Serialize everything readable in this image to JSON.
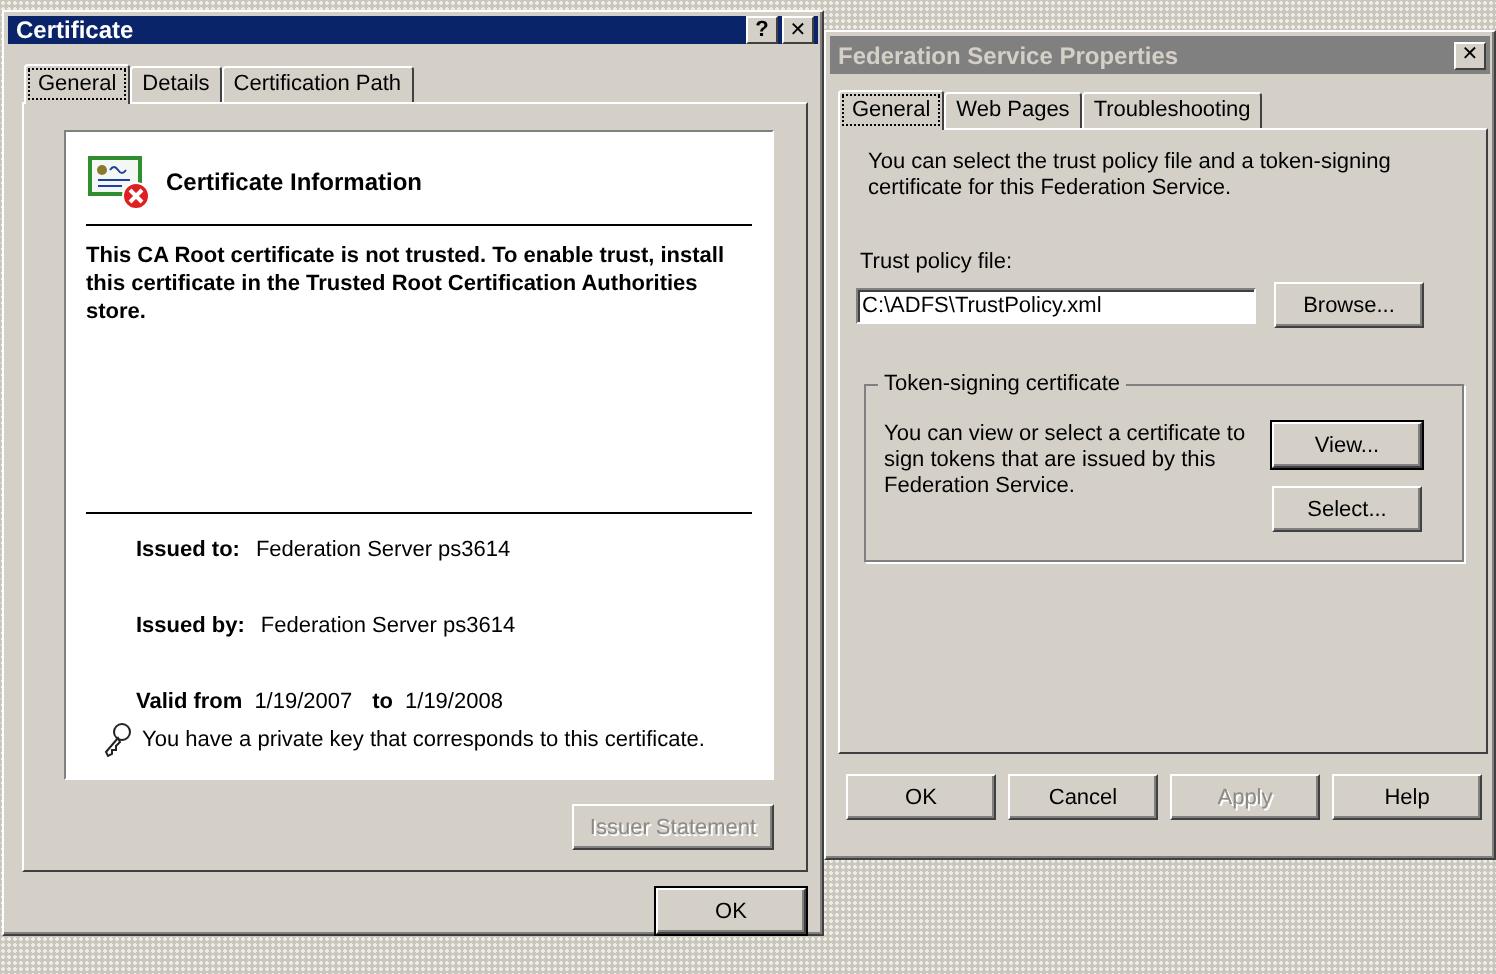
{
  "windows": [
    {
      "kind": "certificate",
      "title": "Certificate",
      "active": true,
      "title_buttons": [
        {
          "kind": "help",
          "label": "?"
        },
        {
          "kind": "close",
          "label": "✕"
        }
      ],
      "tabs": [
        {
          "label": "General",
          "selected": true
        },
        {
          "label": "Details",
          "selected": false
        },
        {
          "label": "Certification Path",
          "selected": false
        }
      ],
      "heading": "Certificate Information",
      "status": "This CA Root certificate is not trusted. To enable trust, install this certificate in the Trusted Root Certification Authorities store.",
      "fields": [
        {
          "label": "Issued to:",
          "value": "Federation Server ps3614"
        },
        {
          "label": "Issued by:",
          "value": "Federation Server ps3614"
        }
      ],
      "validity": {
        "from_label": "Valid from",
        "from": "1/19/2007",
        "to_label": "to",
        "to": "1/19/2008"
      },
      "key_note": "You have a private key that corresponds to this certificate.",
      "panel_buttons": [
        {
          "label": "Issuer Statement",
          "disabled": true
        }
      ],
      "buttons": [
        {
          "label": "OK",
          "disabled": false,
          "default": true
        }
      ]
    },
    {
      "kind": "properties",
      "title": "Federation Service Properties",
      "active": false,
      "title_buttons": [
        {
          "kind": "close",
          "label": "✕"
        }
      ],
      "tabs": [
        {
          "label": "General",
          "selected": true
        },
        {
          "label": "Web Pages",
          "selected": false
        },
        {
          "label": "Troubleshooting",
          "selected": false
        }
      ],
      "intro": "You can select the trust policy file and a token-signing certificate for this Federation Service.",
      "field": {
        "label": "Trust policy file:",
        "value": "C:\\ADFS\\TrustPolicy.xml",
        "button": {
          "label": "Browse...",
          "disabled": false,
          "default": false
        }
      },
      "group": {
        "legend": "Token-signing certificate",
        "text": "You can view or select a certificate to sign tokens that are issued by this Federation Service.",
        "buttons": [
          {
            "label": "View...",
            "disabled": false,
            "default": true
          },
          {
            "label": "Select...",
            "disabled": false,
            "default": false
          }
        ]
      },
      "buttons": [
        {
          "label": "OK",
          "disabled": false,
          "default": false
        },
        {
          "label": "Cancel",
          "disabled": false,
          "default": false
        },
        {
          "label": "Apply",
          "disabled": true,
          "default": false
        },
        {
          "label": "Help",
          "disabled": false,
          "default": false
        }
      ]
    }
  ]
}
